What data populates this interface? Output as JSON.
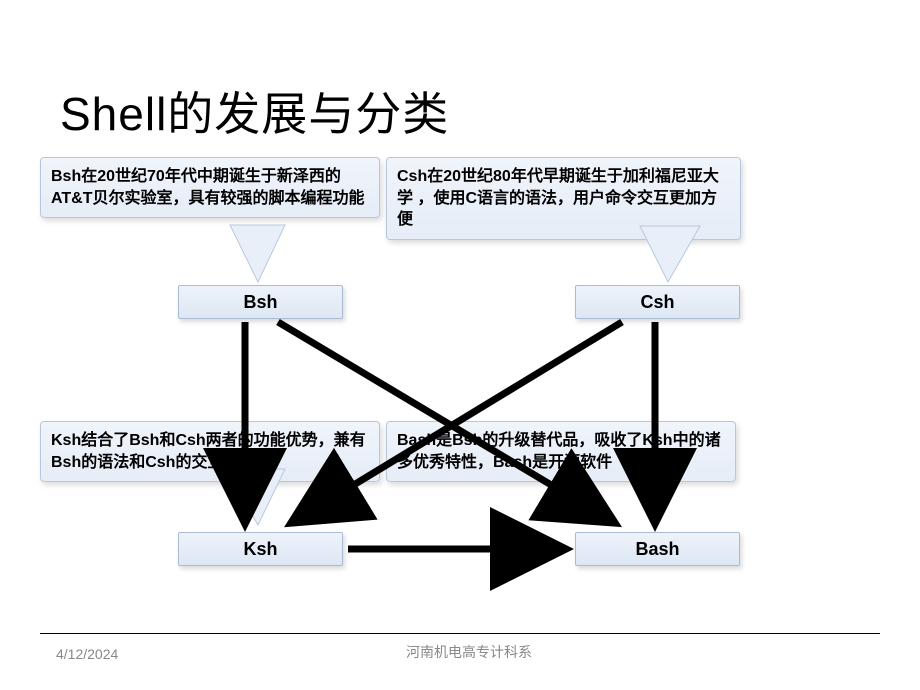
{
  "title": "Shell的发展与分类",
  "callouts": {
    "bsh": "Bsh在20世纪70年代中期诞生于新泽西的AT&T贝尔实验室，具有较强的脚本编程功能",
    "csh": "Csh在20世纪80年代早期诞生于加利福尼亚大学 ，使用C语言的语法，用户命令交互更加方便",
    "ksh": "Ksh结合了Bsh和Csh两者的功能优势，兼有Bsh的语法和Csh的交互特性",
    "bash": "Bash是Bsh的升级替代品，吸收了Ksh中的诸多优秀特性，Bash是开源软件"
  },
  "nodes": {
    "bsh": "Bsh",
    "csh": "Csh",
    "ksh": "Ksh",
    "bash": "Bash"
  },
  "footer": {
    "date": "4/12/2024",
    "org": "河南机电高专计科系"
  },
  "chart_data": {
    "type": "diagram",
    "title": "Shell的发展与分类",
    "nodes": [
      {
        "id": "Bsh",
        "desc": "Bsh在20世纪70年代中期诞生于新泽西的AT&T贝尔实验室，具有较强的脚本编程功能"
      },
      {
        "id": "Csh",
        "desc": "Csh在20世纪80年代早期诞生于加利福尼亚大学 ，使用C语言的语法，用户命令交互更加方便"
      },
      {
        "id": "Ksh",
        "desc": "Ksh结合了Bsh和Csh两者的功能优势，兼有Bsh的语法和Csh的交互特性"
      },
      {
        "id": "Bash",
        "desc": "Bash是Bsh的升级替代品，吸收了Ksh中的诸多优秀特性，Bash是开源软件"
      }
    ],
    "edges": [
      {
        "from": "Bsh",
        "to": "Ksh"
      },
      {
        "from": "Csh",
        "to": "Ksh"
      },
      {
        "from": "Bsh",
        "to": "Bash"
      },
      {
        "from": "Csh",
        "to": "Bash"
      },
      {
        "from": "Ksh",
        "to": "Bash"
      }
    ]
  }
}
